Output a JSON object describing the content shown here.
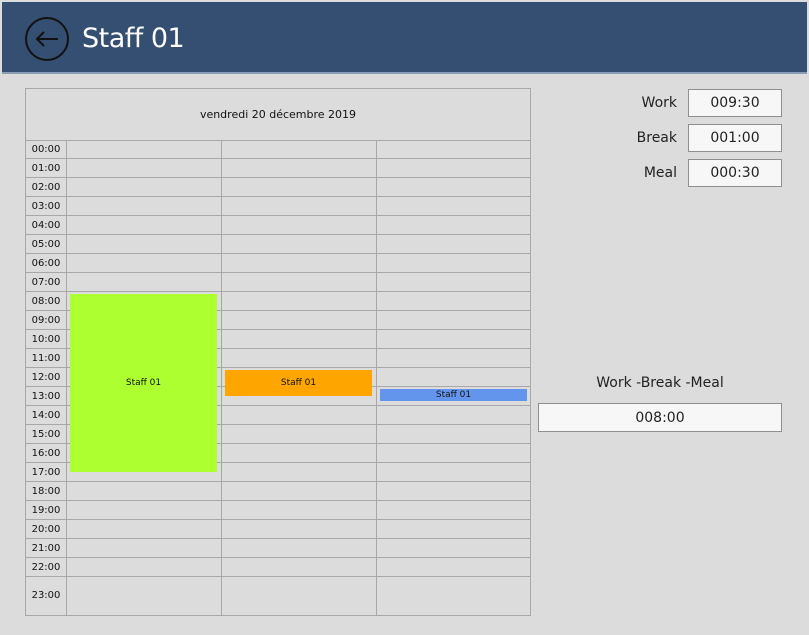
{
  "header": {
    "title": "Staff 01",
    "back_icon": "arrow-left-icon",
    "background": "#354f72"
  },
  "scheduler": {
    "date": "vendredi 20 décembre 2019",
    "hours": [
      "00:00",
      "01:00",
      "02:00",
      "03:00",
      "04:00",
      "05:00",
      "06:00",
      "07:00",
      "08:00",
      "09:00",
      "10:00",
      "11:00",
      "12:00",
      "13:00",
      "14:00",
      "15:00",
      "16:00",
      "17:00",
      "18:00",
      "19:00",
      "20:00",
      "21:00",
      "22:00",
      "23:00"
    ],
    "appointments": [
      {
        "label": "Staff 01",
        "column": 1,
        "start": "08:00",
        "end": "17:30",
        "color": "#adff2f"
      },
      {
        "label": "Staff 01",
        "column": 2,
        "start": "12:00",
        "end": "13:30",
        "color": "#ffa500"
      },
      {
        "label": "Staff 01",
        "column": 3,
        "start": "13:00",
        "end": "13:30",
        "color": "#6495ed"
      }
    ]
  },
  "fields": {
    "work": {
      "label": "Work",
      "value": "009:30"
    },
    "break": {
      "label": "Break",
      "value": "001:00"
    },
    "meal": {
      "label": "Meal",
      "value": "000:30"
    }
  },
  "summary": {
    "label": "Work -Break -Meal",
    "value": "008:00"
  }
}
